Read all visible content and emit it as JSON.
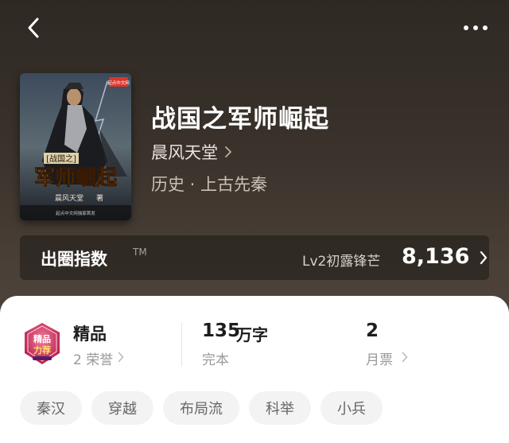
{
  "header": {
    "back_icon": "chevron-left-icon",
    "more_icon": "more-horizontal-icon"
  },
  "book": {
    "title": "战国之军师崛起",
    "author": "晨风天堂",
    "category": "历史 · 上古先秦",
    "cover": {
      "small_title": "[战国之]",
      "big_title": "军师崛起",
      "author": "晨风天堂",
      "author_suffix": "著",
      "publisher_badge": "起点中文网",
      "footer_text": "起点中文网独家首发"
    }
  },
  "index_bar": {
    "label": "出圈指数",
    "tm": "TM",
    "level": "Lv2初露锋芒",
    "value": "8,136"
  },
  "stats": {
    "honor": {
      "main": "精品",
      "sub": "2 荣誉",
      "badge_line1": "精品",
      "badge_line2": "力荐"
    },
    "words": {
      "main_number": "135",
      "main_unit": "万字",
      "sub": "完本"
    },
    "tickets": {
      "main": "2",
      "sub": "月票"
    }
  },
  "tags": [
    "秦汉",
    "穿越",
    "布局流",
    "科举",
    "小兵"
  ],
  "colors": {
    "header_bg_top": "#2f2924",
    "header_bg_bottom": "#554a40",
    "card_bg": "#ffffff",
    "tag_bg": "#f3f3f3",
    "badge_red": "#c8234a"
  }
}
